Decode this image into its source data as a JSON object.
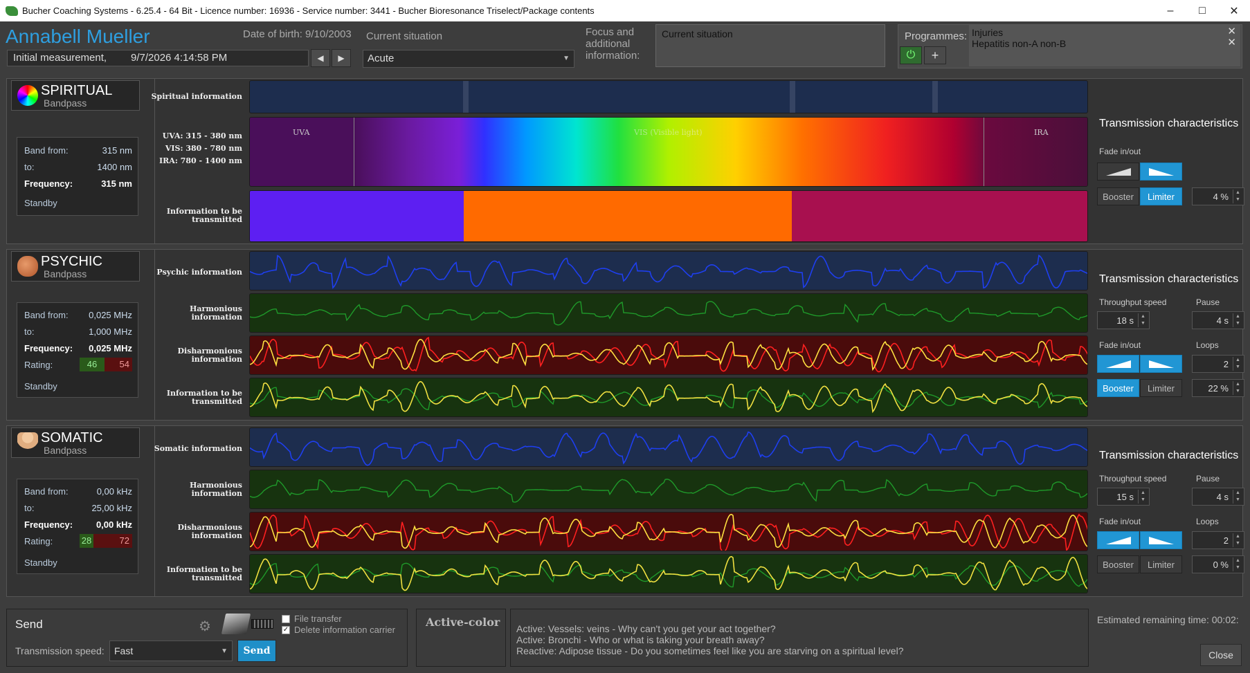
{
  "window": {
    "title": "Bucher Coaching Systems - 6.25.4 - 64 Bit - Licence number: 16936 - Service number: 3441 - Bucher Bioresonance Triselect/Package contents",
    "minimize": "–",
    "maximize": "□",
    "close": "✕"
  },
  "header": {
    "patient_name": "Annabell Mueller",
    "dob": "Date of birth: 9/10/2003",
    "measurement_label": "Initial measurement,",
    "measurement_date": "9/7/2026 4:14:58 PM",
    "prev": "◀",
    "next": "▶",
    "situation_label": "Current situation",
    "situation_value": "Acute",
    "focus_label": "Focus and additional information:",
    "focus_value": "Current situation",
    "programmes_label": "Programmes:",
    "programmes": [
      "Injuries",
      "Hepatitis non-A non-B"
    ],
    "remove": "✕",
    "power": "⏻",
    "add": "+"
  },
  "spiritual": {
    "title": "SPIRITUAL",
    "subtitle": "Bandpass",
    "band_from_label": "Band from:",
    "band_from": "315 nm",
    "to_label": "to:",
    "to": "1400 nm",
    "freq_label": "Frequency:",
    "freq": "315 nm",
    "standby": "Standby",
    "row1": "Spiritual information",
    "uva": "UVA: 315 - 380 nm",
    "vis": "VIS: 380 - 780 nm",
    "ira": "IRA: 780 - 1400 nm",
    "row3": "Information to be transmitted",
    "spec_uva": "UVA",
    "spec_vis": "VIS (Visible light)",
    "spec_ira": "IRA",
    "tc": "Transmission characteristics",
    "fade": "Fade in/out",
    "booster": "Booster",
    "limiter": "Limiter",
    "pct": "4 %"
  },
  "psychic": {
    "title": "PSYCHIC",
    "subtitle": "Bandpass",
    "band_from_label": "Band from:",
    "band_from": "0,025 MHz",
    "to_label": "to:",
    "to": "1,000 MHz",
    "freq_label": "Frequency:",
    "freq": "0,025 MHz",
    "rating_label": "Rating:",
    "rating_good": "46",
    "rating_bad": "54",
    "standby": "Standby",
    "row1": "Psychic information",
    "row2": "Harmonious information",
    "row3": "Disharmonious information",
    "row4": "Information to be transmitted",
    "tc": "Transmission characteristics",
    "speed_label": "Throughput speed",
    "speed": "18 s",
    "pause_label": "Pause",
    "pause": "4 s",
    "fade": "Fade in/out",
    "loops_label": "Loops",
    "loops": "2",
    "booster": "Booster",
    "limiter": "Limiter",
    "pct": "22 %"
  },
  "somatic": {
    "title": "SOMATIC",
    "subtitle": "Bandpass",
    "band_from_label": "Band from:",
    "band_from": "0,00 kHz",
    "to_label": "to:",
    "to": "25,00 kHz",
    "freq_label": "Frequency:",
    "freq": "0,00 kHz",
    "rating_label": "Rating:",
    "rating_good": "28",
    "rating_bad": "72",
    "standby": "Standby",
    "row1": "Somatic information",
    "row2": "Harmonious information",
    "row3": "Disharmonious information",
    "row4": "Information to be transmitted",
    "tc": "Transmission characteristics",
    "speed_label": "Throughput speed",
    "speed": "15 s",
    "pause_label": "Pause",
    "pause": "4 s",
    "fade": "Fade in/out",
    "loops_label": "Loops",
    "loops": "2",
    "booster": "Booster",
    "limiter": "Limiter",
    "pct": "0 %"
  },
  "footer": {
    "send_title": "Send",
    "speed_label": "Transmission speed:",
    "speed_value": "Fast",
    "send_button": "Send",
    "file_transfer": "File transfer",
    "delete_carrier": "Delete information carrier",
    "active_color": "Active-color",
    "messages": [
      "Active: Vessels: veins - Why can't you get your act together?",
      "Active: Bronchi - Who or what is taking your breath away?",
      "Reactive: Adipose tissue - Do you sometimes feel like you are starving on a spiritual level?"
    ],
    "remaining": "Estimated remaining time: 00:02:",
    "close": "Close"
  },
  "colors": {
    "accent": "#2196d4",
    "name": "#2e9fe0",
    "transmit_spiritual": [
      "#5d1ff2",
      "#ff6a00",
      "#a8104f"
    ]
  }
}
